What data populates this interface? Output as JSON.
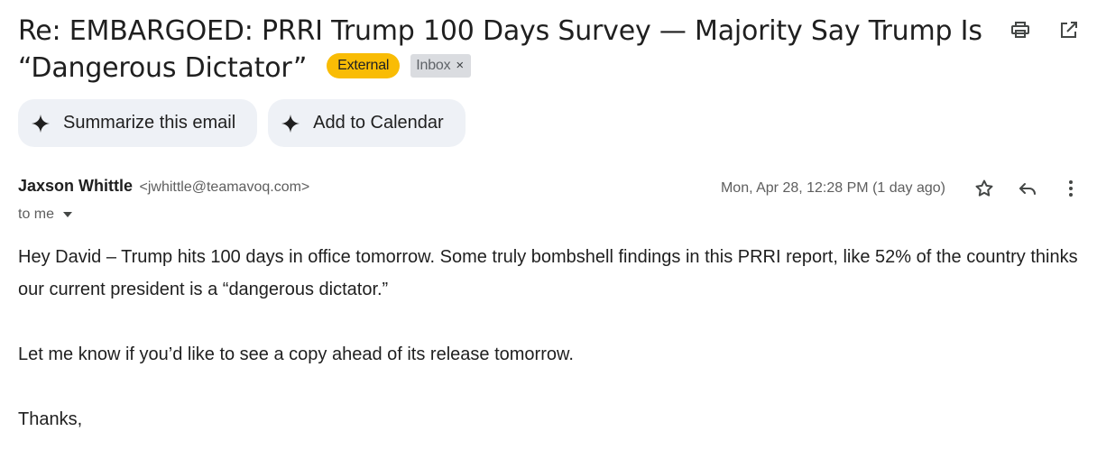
{
  "email": {
    "subject_line1": "Re: EMBARGOED: PRRI Trump 100 Days Survey — Majority Say Trump Is",
    "subject_line2": "“Dangerous Dictator”",
    "labels": {
      "external": "External",
      "inbox": "Inbox",
      "inbox_remove": "×"
    },
    "actions_top": {
      "print_icon": "print-icon",
      "open_new_window_icon": "open-in-new-icon"
    },
    "chips": [
      {
        "icon": "sparkle-icon",
        "label": "Summarize this email"
      },
      {
        "icon": "sparkle-icon",
        "label": "Add to Calendar"
      }
    ],
    "sender": {
      "name": "Jaxson Whittle",
      "email": "<jwhittle@teamavoq.com>",
      "to": "to me"
    },
    "date": "Mon, Apr 28, 12:28 PM (1 day ago)",
    "message_actions": [
      "star-icon",
      "reply-icon",
      "more-vert-icon"
    ],
    "body": {
      "p1": "Hey David – Trump hits 100 days in office tomorrow. Some truly bombshell findings in this PRRI report, like 52% of the country thinks our current president is a “dangerous dictator.”",
      "p2": "Let me know if you’d like to see a copy ahead of its release tomorrow.",
      "p3": "Thanks,"
    }
  },
  "colors": {
    "external_badge": "#f9bc05",
    "inbox_badge": "#dadce0",
    "chip_bg": "#eef1f6",
    "text_primary": "#1f1f1f",
    "text_secondary": "#5e5e5e"
  }
}
